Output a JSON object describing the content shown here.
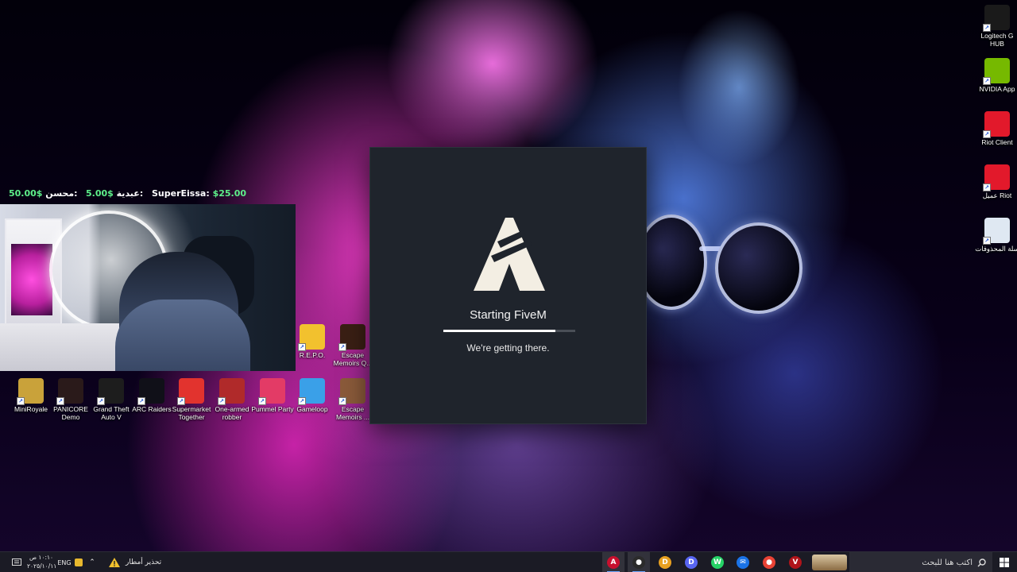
{
  "donations": [
    {
      "name": "SuperEissa:",
      "amount": "$25.00"
    },
    {
      "name": "عبدية:",
      "amount": "5.00$"
    },
    {
      "name": "محسن:",
      "amount": "50.00$"
    }
  ],
  "desktop_icons_right": [
    {
      "label": "Logitech G HUB",
      "icon": "logitech-g-icon",
      "color": "#1a1a1a"
    },
    {
      "label": "NVIDIA App",
      "icon": "nvidia-icon",
      "color": "#76b900"
    },
    {
      "label": "Riot Client",
      "icon": "riot-icon",
      "color": "#e2192b"
    },
    {
      "label": "عميل Riot",
      "icon": "riot-icon",
      "color": "#e2192b"
    },
    {
      "label": "سلة المحذوفات",
      "icon": "recycle-bin-icon",
      "color": "#dfe8f2"
    }
  ],
  "desktop_icons_row1": [
    {
      "label": "R.E.P.O.",
      "icon": "repo-icon",
      "color": "#f2c12e"
    },
    {
      "label": "Escape Memoirs Q...",
      "icon": "escape-memoirs-icon",
      "color": "#3a1f14"
    }
  ],
  "desktop_icons_row2": [
    {
      "label": "MiniRoyale",
      "icon": "miniroyale-icon",
      "color": "#c9a23a"
    },
    {
      "label": "PANICORE Demo",
      "icon": "panicore-icon",
      "color": "#2a1a1a"
    },
    {
      "label": "Grand Theft Auto V",
      "icon": "gta-v-icon",
      "color": "#1d1d1d"
    },
    {
      "label": "ARC Raiders",
      "icon": "arc-raiders-icon",
      "color": "#101018"
    },
    {
      "label": "Supermarket Together",
      "icon": "supermarket-together-icon",
      "color": "#e2332e"
    },
    {
      "label": "One-armed robber",
      "icon": "one-armed-robber-icon",
      "color": "#b02a2a"
    },
    {
      "label": "Pummel Party",
      "icon": "pummel-party-icon",
      "color": "#e33b66"
    },
    {
      "label": "Gameloop",
      "icon": "gameloop-icon",
      "color": "#3aa0e8"
    },
    {
      "label": "Escape Memoirs ...",
      "icon": "escape-memoirs-icon",
      "color": "#8a5a3a"
    }
  ],
  "launcher": {
    "title": "Starting FiveM",
    "subtitle": "We're getting there.",
    "progress": 0.85,
    "accent": "#f3eee3"
  },
  "taskbar": {
    "search_placeholder": "اكتب هنا للبحث",
    "weather_text": "تحذير أمطار",
    "language": "ENG",
    "time": "١٠:١٠ ص",
    "date": "٢٠٢٥/١٠/١١",
    "apps": [
      {
        "name": "fivem",
        "icon": "fivem-icon",
        "color": "#c8102e",
        "glyph": "A",
        "active": true
      },
      {
        "name": "obs",
        "icon": "obs-icon",
        "color": "#2b2b2b",
        "glyph": "●",
        "active": true
      },
      {
        "name": "discord-app",
        "icon": "chat-icon",
        "color": "#e8a020",
        "glyph": "D",
        "active": false
      },
      {
        "name": "discord",
        "icon": "discord-icon",
        "color": "#5865f2",
        "glyph": "D",
        "active": false
      },
      {
        "name": "whatsapp",
        "icon": "whatsapp-icon",
        "color": "#25d366",
        "glyph": "W",
        "active": false
      },
      {
        "name": "mail",
        "icon": "mail-icon",
        "color": "#1a73e8",
        "glyph": "✉",
        "active": false
      },
      {
        "name": "chrome",
        "icon": "chrome-icon",
        "color": "#e94235",
        "glyph": "●",
        "active": false
      },
      {
        "name": "voicemeeter",
        "icon": "voicemeeter-icon",
        "color": "#b0141a",
        "glyph": "V",
        "active": false
      }
    ]
  }
}
